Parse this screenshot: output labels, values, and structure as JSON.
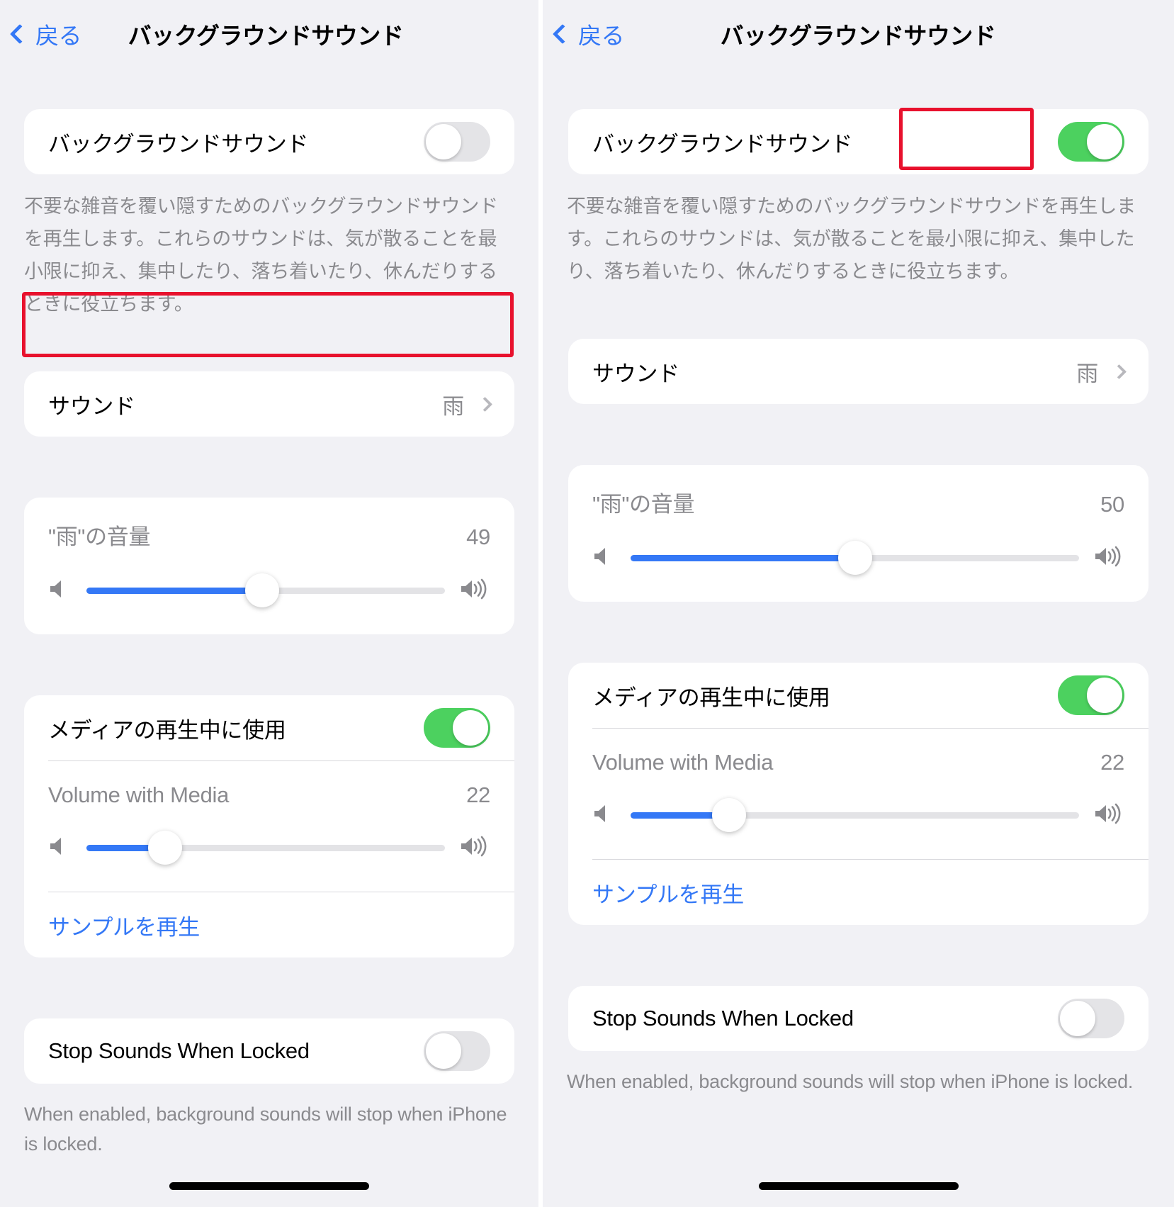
{
  "nav": {
    "back_label": "戻る",
    "title": "バックグラウンドサウンド"
  },
  "left_panel": {
    "main_toggle": {
      "label": "バックグラウンドサウンド",
      "state": "off"
    },
    "description": "不要な雑音を覆い隠すためのバックグラウンドサウンドを再生します。これらのサウンドは、気が散ることを最小限に抑え、集中したり、落ち着いたり、休んだりするときに役立ちます。",
    "sound_row": {
      "label": "サウンド",
      "value": "雨"
    },
    "sound_volume": {
      "label": "\"雨\"の音量",
      "value": "49",
      "percent": 49
    },
    "use_with_media": {
      "label": "メディアの再生中に使用",
      "state": "on"
    },
    "media_volume": {
      "label": "Volume with Media",
      "value": "22",
      "percent": 22
    },
    "play_sample": {
      "label": "サンプルを再生"
    },
    "stop_when_locked": {
      "label": "Stop Sounds When Locked",
      "state": "off"
    },
    "stop_note": "When enabled, background sounds will stop when iPhone is locked."
  },
  "right_panel": {
    "main_toggle": {
      "label": "バックグラウンドサウンド",
      "state": "on"
    },
    "description": "不要な雑音を覆い隠すためのバックグラウンドサウンドを再生します。これらのサウンドは、気が散ることを最小限に抑え、集中したり、落ち着いたり、休んだりするときに役立ちます。",
    "sound_row": {
      "label": "サウンド",
      "value": "雨"
    },
    "sound_volume": {
      "label": "\"雨\"の音量",
      "value": "50",
      "percent": 50
    },
    "use_with_media": {
      "label": "メディアの再生中に使用",
      "state": "on"
    },
    "media_volume": {
      "label": "Volume with Media",
      "value": "22",
      "percent": 22
    },
    "play_sample": {
      "label": "サンプルを再生"
    },
    "stop_when_locked": {
      "label": "Stop Sounds When Locked",
      "state": "off"
    },
    "stop_note": "When enabled, background sounds will stop when iPhone is locked."
  },
  "colors": {
    "accent_blue": "#3478f6",
    "toggle_green": "#4cd15f",
    "annotation_red": "#e8112d",
    "page_bg": "#f1f1f5",
    "card_bg": "#ffffff",
    "secondary_text": "#8a8a8e"
  }
}
